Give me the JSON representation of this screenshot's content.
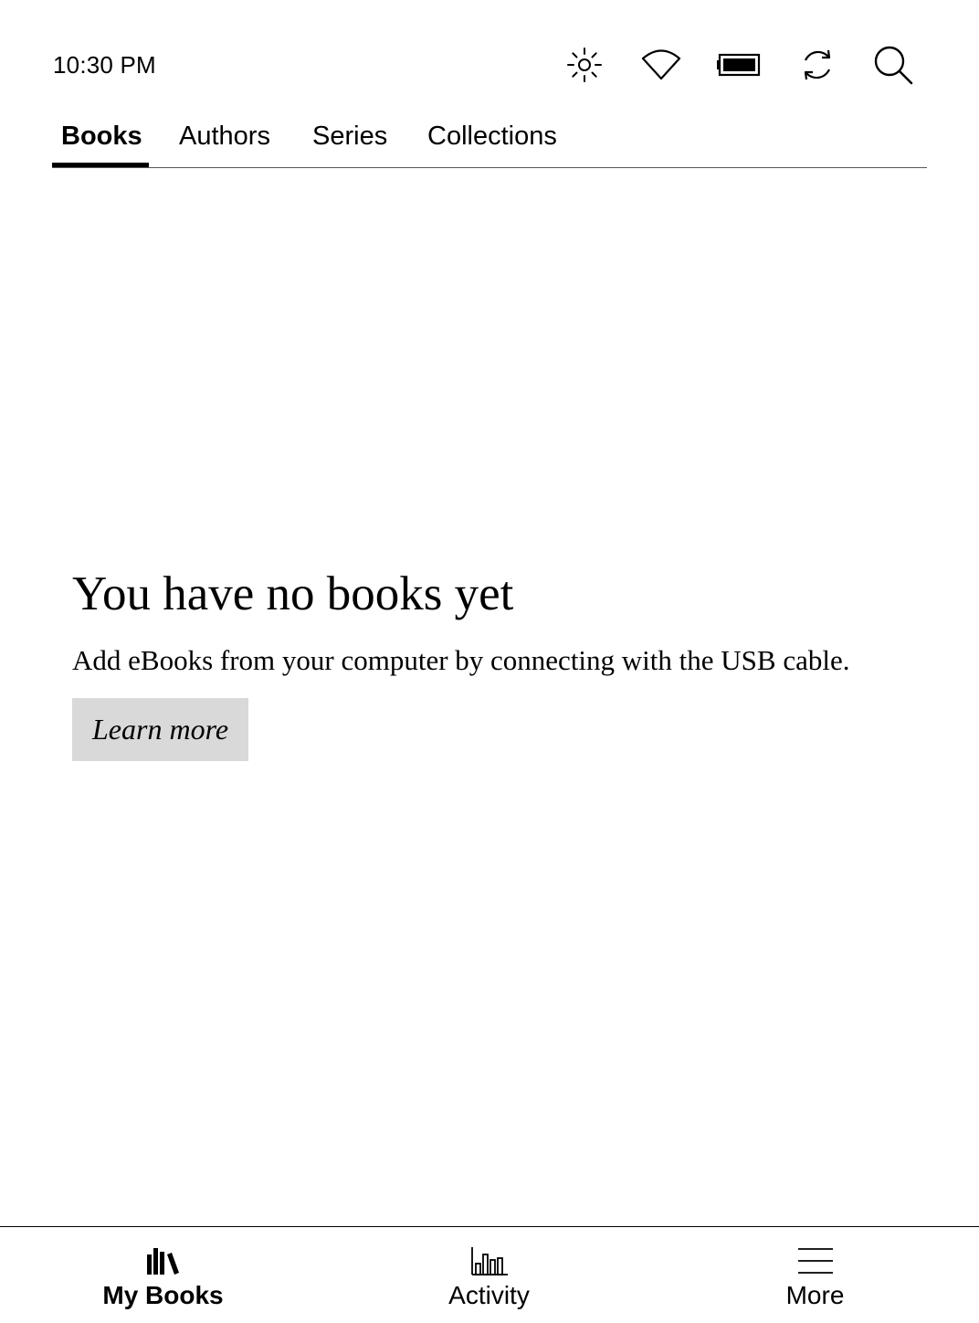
{
  "status_bar": {
    "time": "10:30 PM",
    "icons": [
      "brightness-icon",
      "wifi-icon",
      "battery-icon",
      "sync-icon",
      "search-icon"
    ]
  },
  "tabs": [
    {
      "label": "Books",
      "active": true
    },
    {
      "label": "Authors",
      "active": false
    },
    {
      "label": "Series",
      "active": false
    },
    {
      "label": "Collections",
      "active": false
    }
  ],
  "empty_state": {
    "title": "You have no books yet",
    "body": "Add eBooks from your computer by connecting with the USB cable.",
    "button_label": "Learn more"
  },
  "bottom_nav": [
    {
      "label": "My Books",
      "icon": "books-icon",
      "active": true
    },
    {
      "label": "Activity",
      "icon": "activity-chart-icon",
      "active": false
    },
    {
      "label": "More",
      "icon": "menu-icon",
      "active": false
    }
  ],
  "colors": {
    "background": "#ffffff",
    "text": "#000000",
    "button_background": "#d9d9d9",
    "divider": "#555555"
  }
}
